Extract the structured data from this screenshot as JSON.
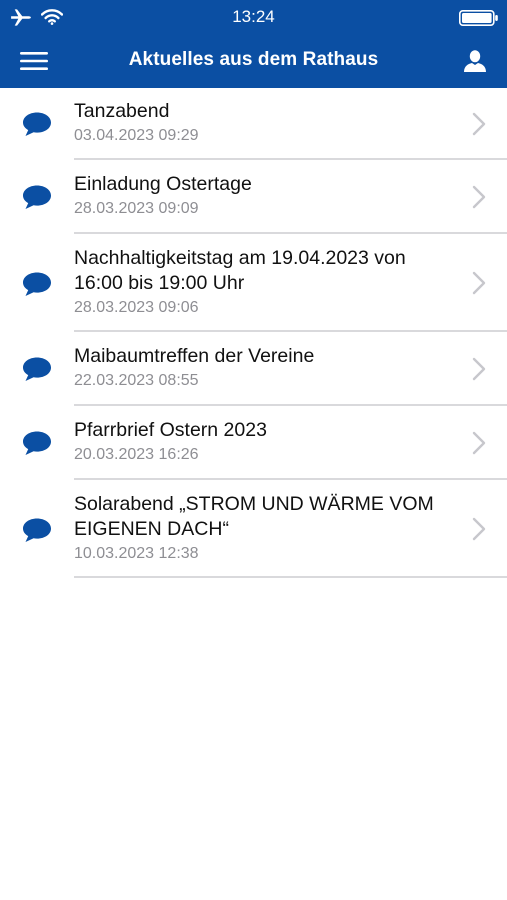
{
  "status_bar": {
    "time": "13:24"
  },
  "nav": {
    "title": "Aktuelles aus dem Rathaus"
  },
  "colors": {
    "brand": "#0b4fa3",
    "bubble": "#0b4fa3",
    "chevron": "#c7c7cc",
    "date_text": "#8e8e93"
  },
  "icons": {
    "menu": "hamburger-menu-icon",
    "profile": "user-icon",
    "item": "speech-bubble-icon",
    "disclosure": "chevron-right-icon"
  },
  "news": [
    {
      "title": "Tanzabend",
      "date": "03.04.2023 09:29"
    },
    {
      "title": "Einladung Ostertage",
      "date": "28.03.2023 09:09"
    },
    {
      "title": "Nachhaltigkeitstag am 19.04.2023 von 16:00 bis 19:00 Uhr",
      "date": "28.03.2023 09:06"
    },
    {
      "title": "Maibaumtreffen der Vereine",
      "date": "22.03.2023 08:55"
    },
    {
      "title": "Pfarrbrief Ostern 2023",
      "date": "20.03.2023 16:26"
    },
    {
      "title": "Solarabend „STROM UND WÄRME VOM EIGENEN DACH“",
      "date": "10.03.2023 12:38"
    }
  ]
}
